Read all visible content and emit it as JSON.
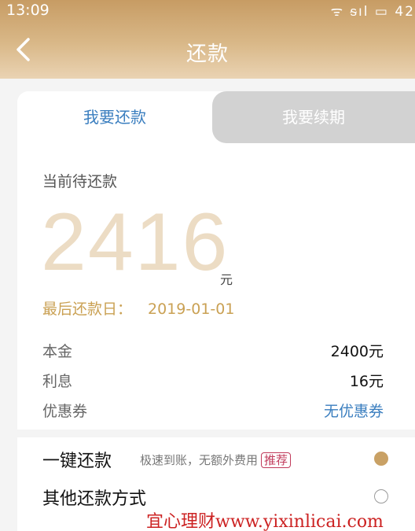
{
  "status_bar": {
    "time": "13:09",
    "icons": "ᯤ ᵴıl ▭ 42"
  },
  "header": {
    "title": "还款"
  },
  "tabs": [
    {
      "label": "我要还款",
      "active": true
    },
    {
      "label": "我要续期",
      "active": false
    }
  ],
  "repayment": {
    "pending_label": "当前待还款",
    "amount": "2416",
    "amount_unit": "元",
    "due_label": "最后还款日：",
    "due_date": "2019-01-01"
  },
  "details": [
    {
      "label": "本金",
      "value": "2400元"
    },
    {
      "label": "利息",
      "value": "16元"
    },
    {
      "label": "优惠券",
      "value": "无优惠券"
    }
  ],
  "options": [
    {
      "title": "一键还款",
      "desc": "极速到账，无额外费用",
      "tag": "推荐",
      "selected": true
    },
    {
      "title": "其他还款方式",
      "selected": false
    }
  ],
  "watermark": "宜心理财www.yixinlicai.com",
  "colors": {
    "accent_gold": "#caa154",
    "accent_blue": "#3a7ebf",
    "tag_red": "#c0395a"
  }
}
